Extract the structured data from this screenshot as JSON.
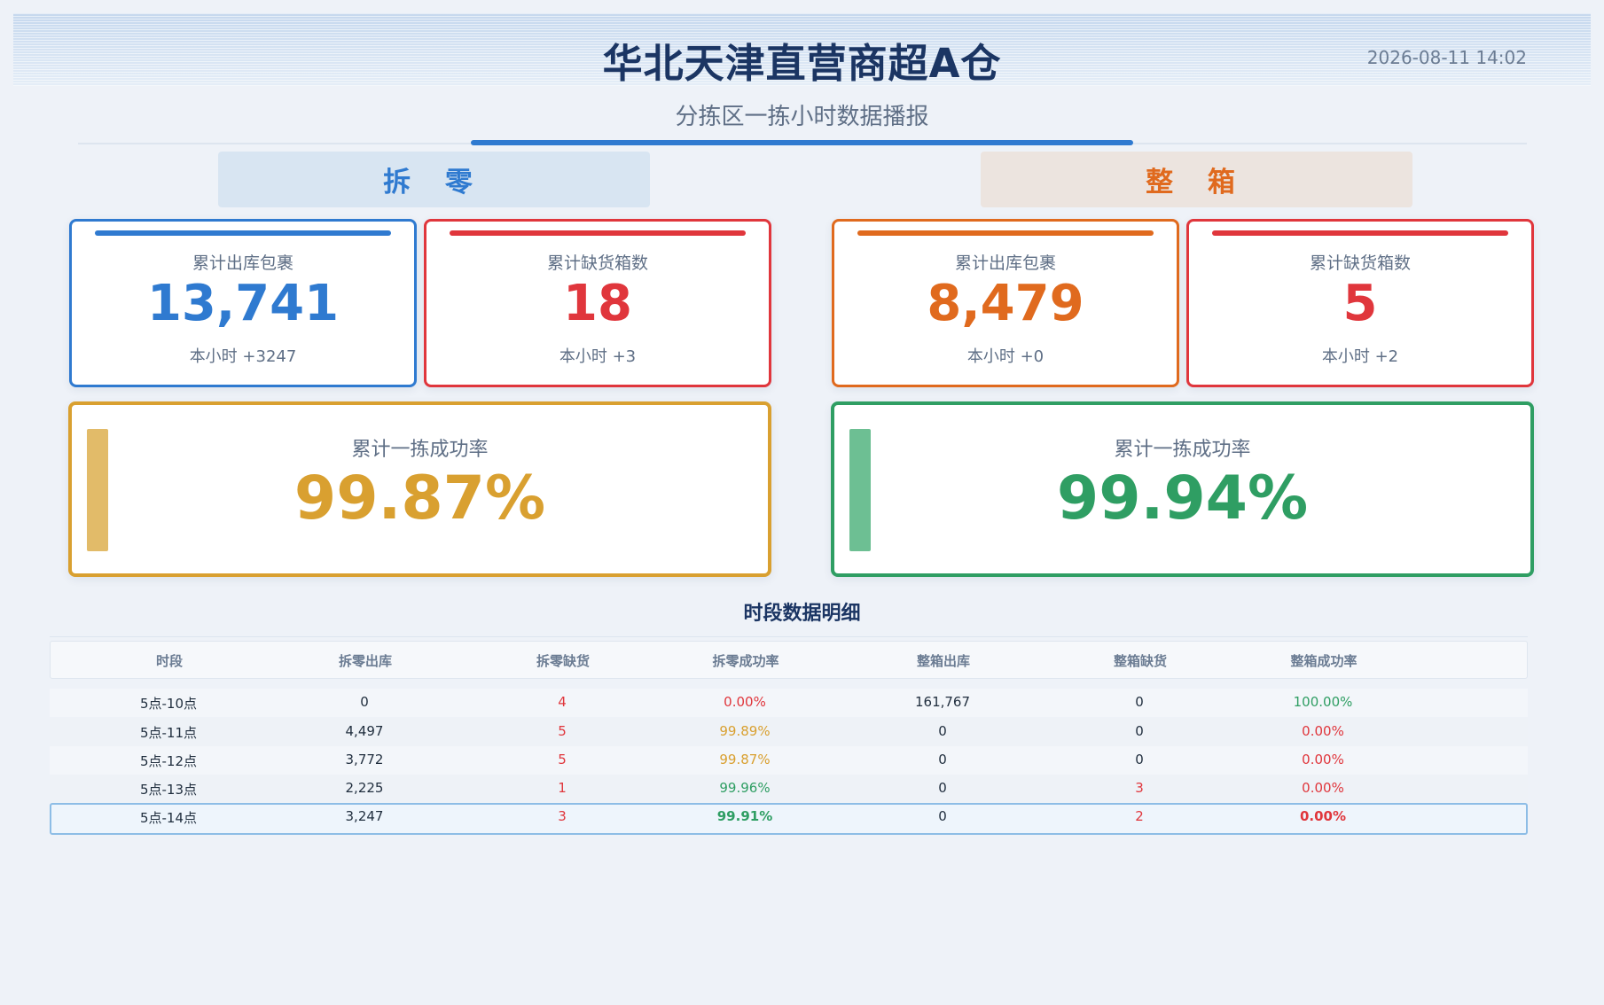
{
  "header": {
    "title": "华北天津直营商超A仓",
    "datetime": "2026-08-11 14:02",
    "subtitle": "分拣区一拣小时数据播报"
  },
  "sections": {
    "left_label": "拆 零",
    "right_label": "整 箱"
  },
  "cards": [
    {
      "label": "累计出库包裹",
      "value": "13,741",
      "sub": "本小时 +3247"
    },
    {
      "label": "累计缺货箱数",
      "value": "18",
      "sub": "本小时 +3"
    },
    {
      "label": "累计出库包裹",
      "value": "8,479",
      "sub": "本小时 +0"
    },
    {
      "label": "累计缺货箱数",
      "value": "5",
      "sub": "本小时 +2"
    }
  ],
  "rates": [
    {
      "label": "累计一拣成功率",
      "value": "99.87%"
    },
    {
      "label": "累计一拣成功率",
      "value": "99.94%"
    }
  ],
  "table": {
    "title": "时段数据明细",
    "headers": [
      "时段",
      "拆零出库",
      "拆零缺货",
      "拆零成功率",
      "整箱出库",
      "整箱缺货",
      "整箱成功率"
    ],
    "rows": [
      [
        "5点-10点",
        "0",
        "4",
        "0.00%",
        "161,767",
        "0",
        "100.00%"
      ],
      [
        "5点-11点",
        "4,497",
        "5",
        "99.89%",
        "0",
        "0",
        "0.00%"
      ],
      [
        "5点-12点",
        "3,772",
        "5",
        "99.87%",
        "0",
        "0",
        "0.00%"
      ],
      [
        "5点-13点",
        "2,225",
        "1",
        "99.96%",
        "0",
        "3",
        "0.00%"
      ],
      [
        "5点-14点",
        "3,247",
        "3",
        "99.91%",
        "0",
        "2",
        "0.00%"
      ]
    ]
  },
  "colors": {
    "blue": "#2f7ad0",
    "red": "#e0363c",
    "orange": "#e06a1e",
    "gold": "#d9a030",
    "green": "#2f9e63"
  }
}
